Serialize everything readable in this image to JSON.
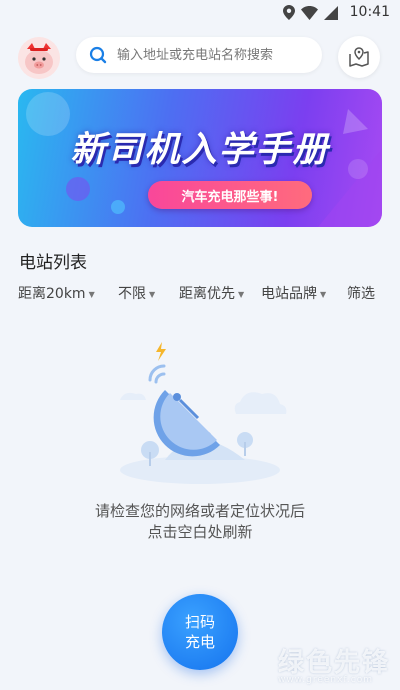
{
  "status_bar": {
    "time": "10:41"
  },
  "search": {
    "placeholder": "输入地址或充电站名称搜索"
  },
  "banner": {
    "title": "新司机入学手册",
    "subtitle": "汽车充电那些事!"
  },
  "section": {
    "title": "电站列表"
  },
  "filters": [
    {
      "label": "距离20km"
    },
    {
      "label": "不限"
    },
    {
      "label": "距离优先"
    },
    {
      "label": "电站品牌"
    },
    {
      "label": "筛选"
    }
  ],
  "empty_state": {
    "line1": "请检查您的网络或者定位状况后",
    "line2": "点击空白处刷新"
  },
  "scan_button": {
    "line1": "扫码",
    "line2": "充电"
  },
  "watermark": {
    "main": "绿色先锋",
    "sub": "www.greenxf.com"
  }
}
